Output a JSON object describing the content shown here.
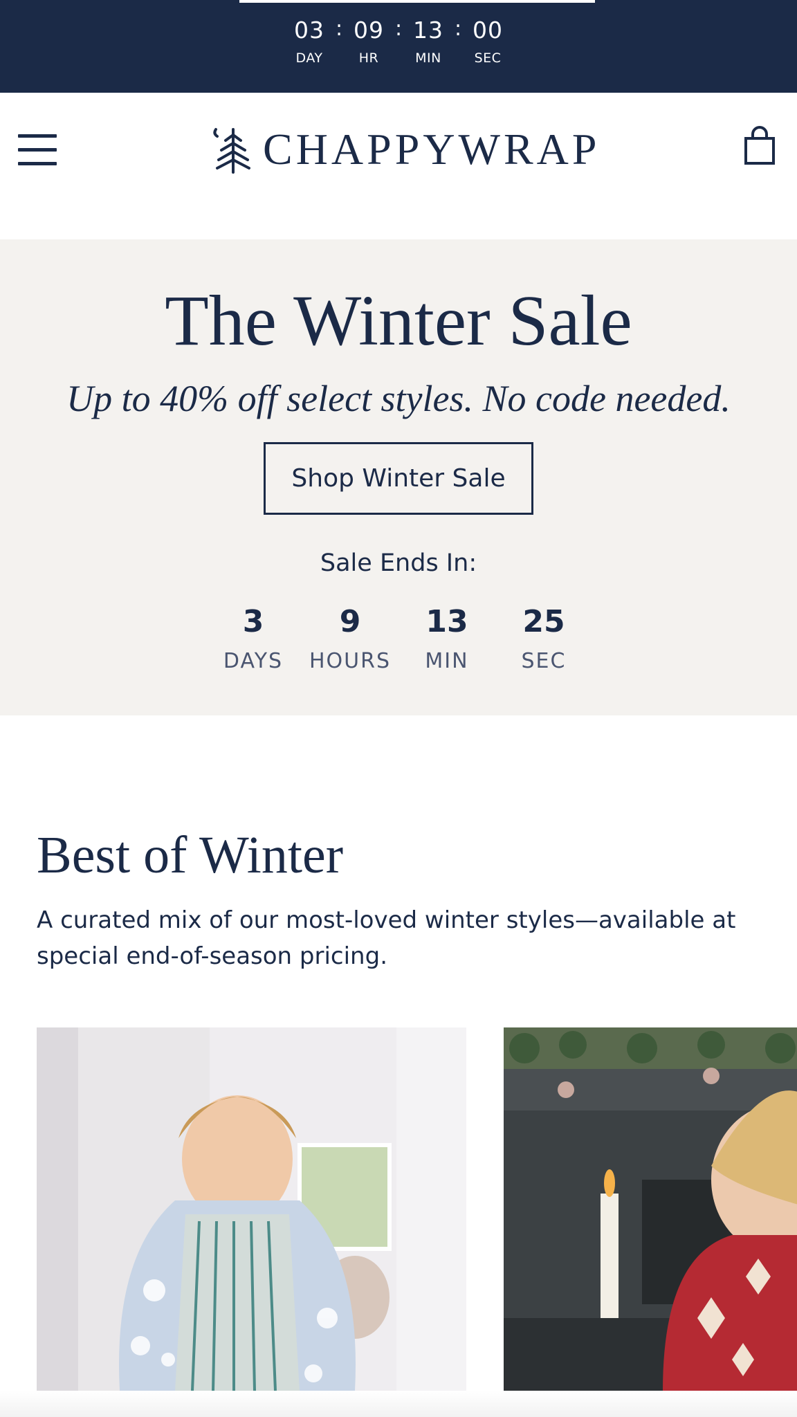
{
  "top_banner": {
    "countdown": [
      {
        "value": "03",
        "label": "DAY"
      },
      {
        "value": "09",
        "label": "HR"
      },
      {
        "value": "13",
        "label": "MIN"
      },
      {
        "value": "00",
        "label": "SEC"
      }
    ],
    "separator": ":"
  },
  "header": {
    "brand": "CHAPPYWRAP",
    "menu_icon": "hamburger-menu-icon",
    "cart_icon": "shopping-bag-icon",
    "logo_icon": "pine-tree-icon"
  },
  "hero": {
    "title": "The Winter Sale",
    "subtitle": "Up to 40% off select styles. No code needed.",
    "button_label": "Shop Winter Sale",
    "ends_label": "Sale Ends In:",
    "countdown": [
      {
        "value": "3",
        "label": "DAYS"
      },
      {
        "value": "9",
        "label": "HOURS"
      },
      {
        "value": "13",
        "label": "MIN"
      },
      {
        "value": "25",
        "label": "SEC"
      }
    ]
  },
  "best_of_winter": {
    "title": "Best of Winter",
    "description": "A curated mix of our most-loved winter styles—available at special end-of-season pricing.",
    "cards": [
      {
        "image": "child-in-blue-snowflake-blanket"
      },
      {
        "image": "woman-in-red-blanket-by-fireplace"
      }
    ]
  },
  "colors": {
    "navy": "#1b2a47",
    "hero_bg": "#f4f2ef",
    "white": "#ffffff"
  }
}
